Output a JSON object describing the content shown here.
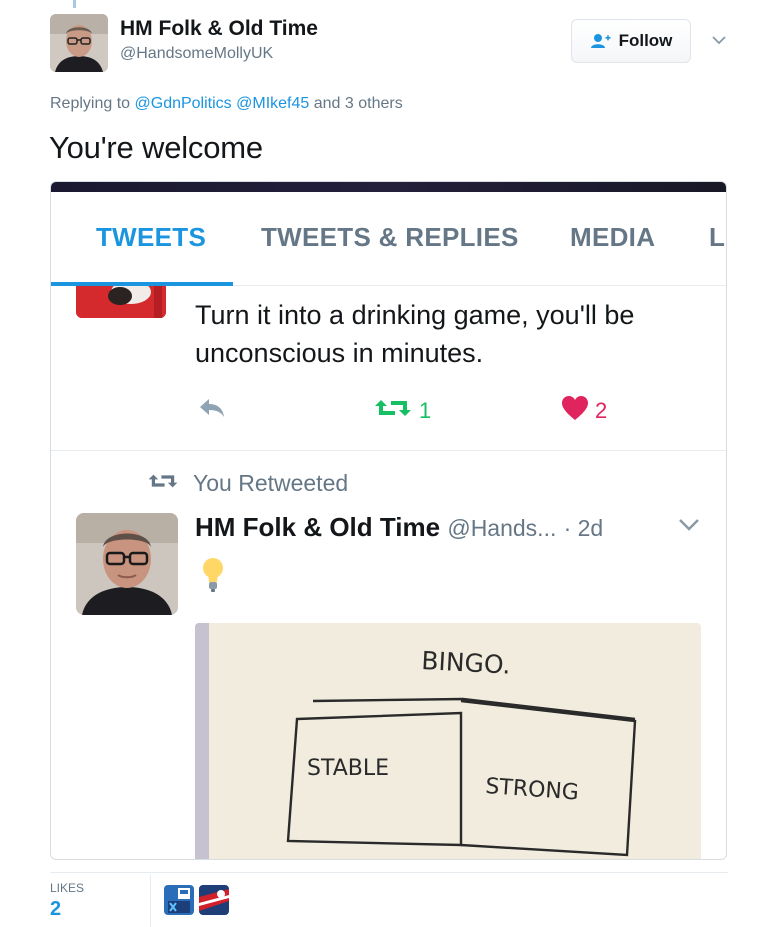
{
  "tweet": {
    "display_name": "HM Folk & Old Time",
    "handle": "@HandsomeMollyUK",
    "follow_label": "Follow",
    "replying_prefix": "Replying to",
    "replying_mention_1": "@GdnPolitics",
    "replying_mention_2": "@MIkef45",
    "replying_suffix": "and 3 others",
    "text": "You're welcome"
  },
  "screenshot": {
    "tabs": [
      {
        "label": "TWEETS"
      },
      {
        "label": "TWEETS & REPLIES"
      },
      {
        "label": "MEDIA"
      },
      {
        "label": "L"
      }
    ],
    "tweet1": {
      "text": "Turn it into a drinking game, you'll be unconscious in minutes.",
      "retweets": "1",
      "likes": "2"
    },
    "retweeted_label": "You Retweeted",
    "tweet2": {
      "name": "HM Folk & Old Time",
      "handle": "@Hands...",
      "time": "· 2d"
    },
    "photo": {
      "title": "BINGO.",
      "cells": [
        "STABLE",
        "STRONG"
      ]
    }
  },
  "footer": {
    "likes_label": "LIKES",
    "likes_count": "2"
  },
  "colors": {
    "accent": "#1b95e0",
    "retweet": "#17bf63",
    "like": "#e0245e",
    "muted": "#657786"
  }
}
